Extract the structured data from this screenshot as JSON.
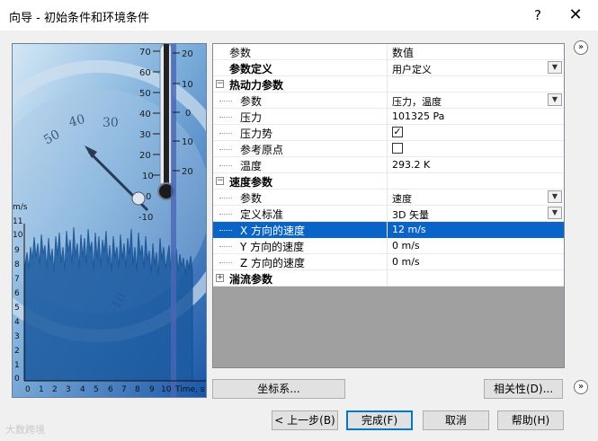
{
  "window": {
    "title": "向导 - 初始条件和环境条件",
    "help_label": "?",
    "close_label": "✕"
  },
  "picture": {
    "thermometer_left_ticks": [
      "70",
      "60",
      "50",
      "40",
      "30",
      "20",
      "10",
      "0",
      "-10"
    ],
    "thermometer_right_ticks": [
      "20",
      "10",
      "0",
      "10",
      "20"
    ],
    "y_axis_unit": "m/s",
    "y_axis_ticks": [
      "11",
      "10",
      "9",
      "8",
      "7",
      "6",
      "5",
      "4",
      "3",
      "2",
      "1",
      "0"
    ],
    "x_axis_ticks": [
      "0",
      "1",
      "2",
      "3",
      "4",
      "5",
      "6",
      "7",
      "8",
      "9",
      "10"
    ],
    "x_axis_unit": "Time, s"
  },
  "grid": {
    "header": {
      "param": "参数",
      "value": "数值"
    },
    "rows": [
      {
        "label": "参数定义",
        "value": "用户定义"
      },
      {
        "label": "热动力参数"
      },
      {
        "label": "参数",
        "value": "压力，温度"
      },
      {
        "label": "压力",
        "value": "101325 Pa"
      },
      {
        "label": "压力势",
        "checked": "✓"
      },
      {
        "label": "参考原点"
      },
      {
        "label": "温度",
        "value": "293.2 K"
      },
      {
        "label": "速度参数"
      },
      {
        "label": "参数",
        "value": "速度"
      },
      {
        "label": "定义标准",
        "value": "3D 矢量"
      },
      {
        "label": "X 方向的速度",
        "value": "12 m/s"
      },
      {
        "label": "Y 方向的速度",
        "value": "0 m/s"
      },
      {
        "label": "Z 方向的速度",
        "value": "0 m/s"
      },
      {
        "label": "湍流参数"
      }
    ]
  },
  "buttons": {
    "coordinate": "坐标系...",
    "dependency": "相关性(D)...",
    "back": "< 上一步(B)",
    "finish": "完成(F)",
    "cancel": "取消",
    "help": "帮助(H)"
  },
  "scroll_glyph": "»",
  "watermark": "大数跨境",
  "colors": {
    "selection": "#0a64c8",
    "primary_border": "#0078d7",
    "grid_bg": "#a0a0a0"
  }
}
